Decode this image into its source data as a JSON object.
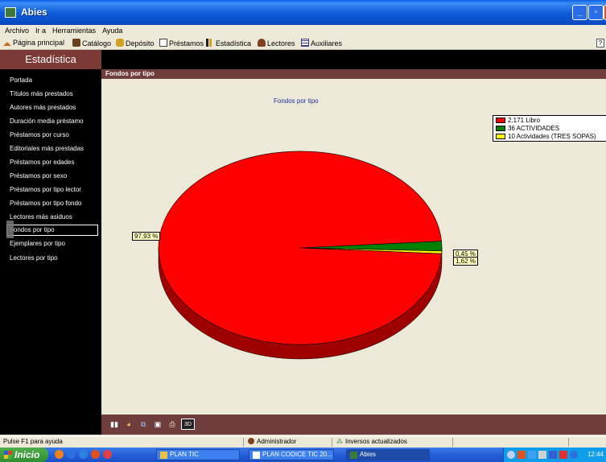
{
  "window": {
    "title": "Abies"
  },
  "menu": [
    "Archivo",
    "Ir a",
    "Herramientas",
    "Ayuda"
  ],
  "toolbar": {
    "items": [
      {
        "label": "Página principal",
        "icon": "home-icon",
        "color": "#c07020"
      },
      {
        "label": "Catálogo",
        "icon": "catalog-icon",
        "color": "#6a4020"
      },
      {
        "label": "Depósito",
        "icon": "deposit-icon",
        "color": "#d0a020"
      },
      {
        "label": "Préstamos",
        "icon": "loans-icon",
        "color": "#404040"
      },
      {
        "label": "Estadística",
        "icon": "statistics-icon",
        "color": "#202020"
      },
      {
        "label": "Lectores",
        "icon": "readers-icon",
        "color": "#804020"
      },
      {
        "label": "Auxiliares",
        "icon": "auxiliary-icon",
        "color": "#404080"
      }
    ],
    "help_label": "?"
  },
  "sidebar": {
    "header": "Estadística",
    "items": [
      "Portada",
      "Títulos más prestados",
      "Autores más prestados",
      "Duración media préstamo",
      "Préstamos por curso",
      "Editoriales más prestadas",
      "Préstamos por edades",
      "Préstamos por sexo",
      "Préstamos por tipo lector",
      "Préstamos por tipo fondo",
      "Lectores más asiduos",
      "Fondos por tipo",
      "Ejemplares por tipo",
      "Lectores por tipo"
    ],
    "selected_index": 11
  },
  "panel": {
    "header": "Fondos por tipo"
  },
  "chart_data": {
    "type": "pie",
    "title": "Fondos por tipo",
    "three_d": true,
    "series": [
      {
        "name": "2.171 Libro",
        "value": 2171,
        "percent_label": "97,93 %",
        "color": "#ff0000"
      },
      {
        "name": "36 ACTIVIDADES",
        "value": 36,
        "percent_label": "1,62 %",
        "color": "#008000"
      },
      {
        "name": "10 Actividades (TRES SOPAS)",
        "value": 10,
        "percent_label": "0,45 %",
        "color": "#ffff00"
      }
    ],
    "legend_position": "top-right"
  },
  "bottom_toolbar": {
    "buttons": [
      {
        "name": "bar-chart-icon",
        "glyph": "▮▮"
      },
      {
        "name": "pie-chart-icon",
        "glyph": "◕"
      },
      {
        "name": "copy-icon",
        "glyph": "⧉"
      },
      {
        "name": "save-icon",
        "glyph": "▣"
      },
      {
        "name": "print-icon",
        "glyph": "⎙"
      },
      {
        "name": "3d-toggle-icon",
        "glyph": "3D"
      }
    ]
  },
  "statusbar": {
    "help": "Pulse F1 para ayuda",
    "user": "Administrador",
    "status": "Inversos actualizados"
  },
  "taskbar": {
    "start_label": "Inicio",
    "tasks": [
      "PLAN TIC",
      "PLAN CODICE TIC 20...",
      "Abies"
    ],
    "clock": "12:44"
  }
}
